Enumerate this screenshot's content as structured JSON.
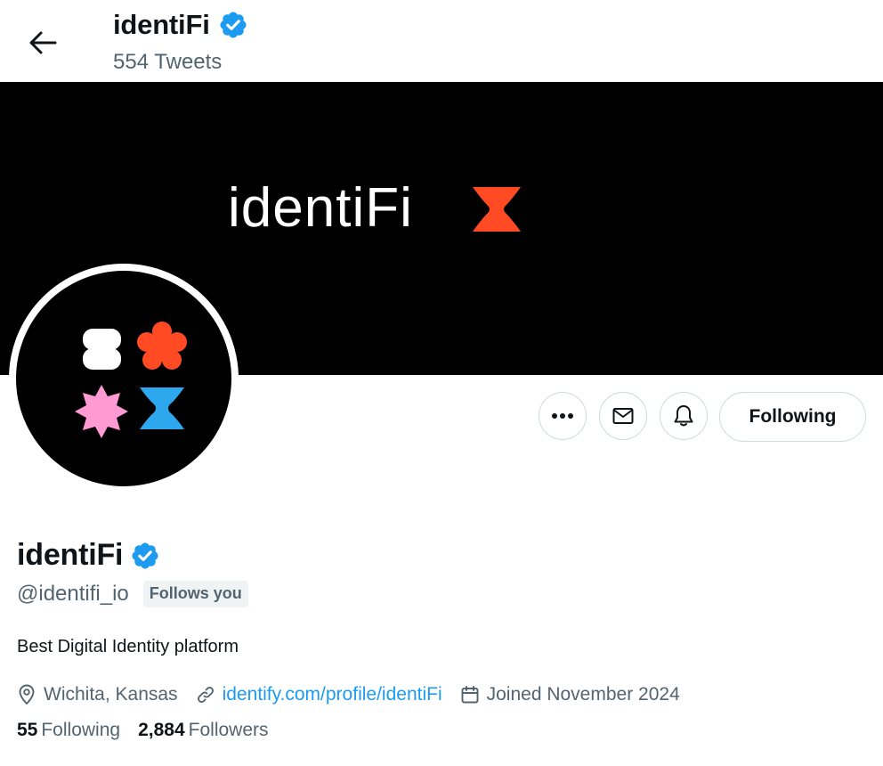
{
  "header": {
    "name": "identiFi",
    "tweet_count": "554 Tweets",
    "back_icon": "arrow-left-icon",
    "verified_icon": "verified-badge-icon"
  },
  "banner": {
    "wordmark": "identiFi",
    "background_color": "#000000",
    "mark_color": "#ff4a23"
  },
  "avatar": {
    "shapes": [
      "white-rounded-s-shape",
      "orange-flower-shape",
      "pink-star-shape",
      "blue-hourglass-shape"
    ],
    "colors": {
      "white": "#ffffff",
      "orange": "#ff4a23",
      "pink": "#ff9ad5",
      "blue": "#2da8ee"
    }
  },
  "actions": {
    "more_icon": "more-dots-icon",
    "message_icon": "envelope-icon",
    "notify_icon": "bell-icon",
    "following_label": "Following"
  },
  "profile": {
    "name": "identiFi",
    "handle": "@identifi_io",
    "follows_you": "Follows you",
    "bio": "Best Digital Identity platform",
    "location": "Wichita, Kansas",
    "website": "identify.com/profile/identiFi",
    "joined": "Joined November 2024",
    "following_count": "55",
    "following_label": "Following",
    "followers_count": "2,884",
    "followers_label": "Followers"
  },
  "colors": {
    "verified": "#1d9bf0",
    "link": "#1d9bf0",
    "secondary_text": "#536471",
    "border": "#cfd9de"
  }
}
